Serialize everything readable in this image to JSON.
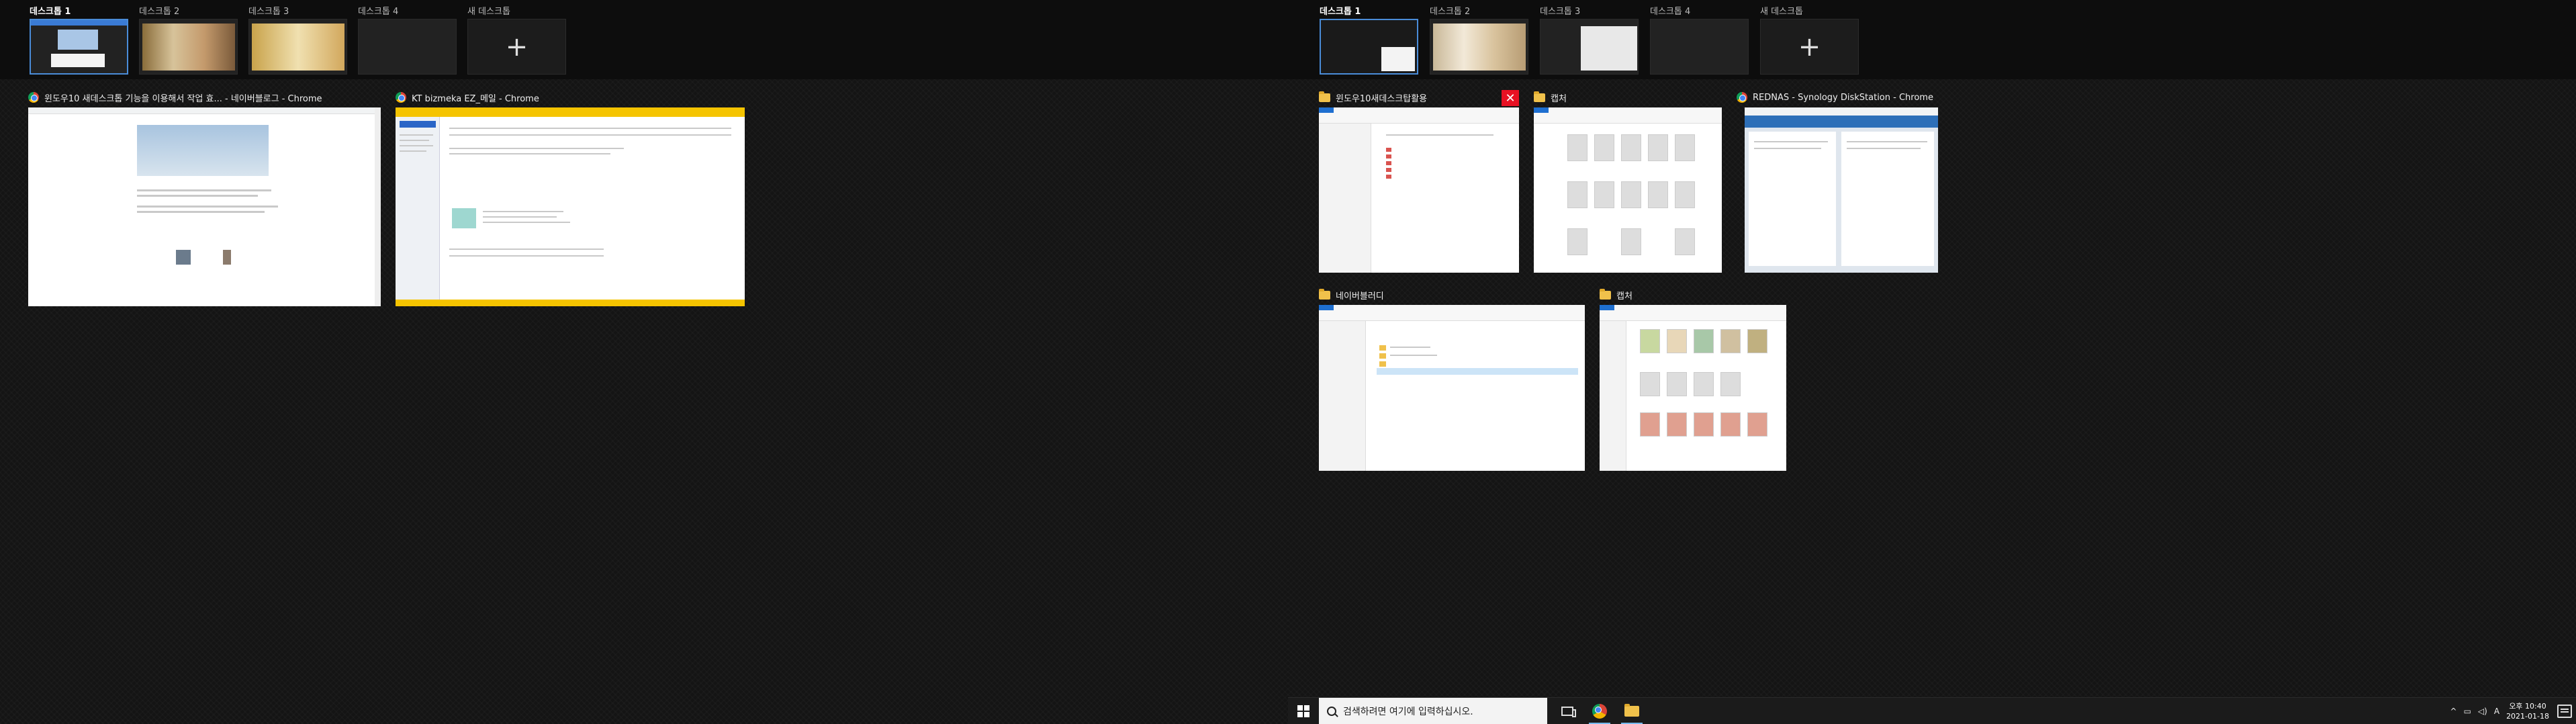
{
  "left_screen": {
    "desktops": [
      {
        "label": "데스크톱 1",
        "active": true
      },
      {
        "label": "데스크톱 2",
        "active": false
      },
      {
        "label": "데스크톱 3",
        "active": false
      },
      {
        "label": "데스크톱 4",
        "active": false
      }
    ],
    "new_desktop_label": "새 데스크톱",
    "new_desktop_plus": "+",
    "windows": [
      {
        "title": "윈도우10 새데스크톱 기능을 이용해서 작업 효... - 네이버블로그 - Chrome",
        "app": "chrome"
      },
      {
        "title": "KT bizmeka EZ_메일 - Chrome",
        "app": "chrome"
      }
    ]
  },
  "right_screen": {
    "desktops": [
      {
        "label": "데스크톱 1",
        "active": true
      },
      {
        "label": "데스크톱 2",
        "active": false
      },
      {
        "label": "데스크톱 3",
        "active": false
      },
      {
        "label": "데스크톱 4",
        "active": false
      }
    ],
    "new_desktop_label": "새 데스크톱",
    "new_desktop_plus": "+",
    "windows": [
      {
        "title": "윈도우10새데스크탑활용",
        "app": "explorer"
      },
      {
        "title": "캡처",
        "app": "explorer"
      },
      {
        "title": "REDNAS - Synology DiskStation - Chrome",
        "app": "chrome"
      },
      {
        "title": "네이버블러디",
        "app": "explorer"
      },
      {
        "title": "캡처",
        "app": "explorer"
      }
    ],
    "close_glyph": "✕"
  },
  "taskbar": {
    "search_placeholder": "검색하려면 여기에 입력하십시오.",
    "tray": {
      "chevron": "^",
      "ime": "A",
      "time": "오후 10:40",
      "date": "2021-01-18"
    }
  },
  "colors": {
    "active_desktop_border": "#4a8cd8",
    "close_button": "#e81123",
    "kt_yellow": "#f5c400",
    "taskbar_indicator": "#76b9ed"
  },
  "icons": [
    "chrome-icon",
    "folder-icon",
    "windows-logo-icon",
    "search-icon",
    "task-view-icon",
    "notification-icon",
    "plus-icon",
    "close-icon"
  ]
}
